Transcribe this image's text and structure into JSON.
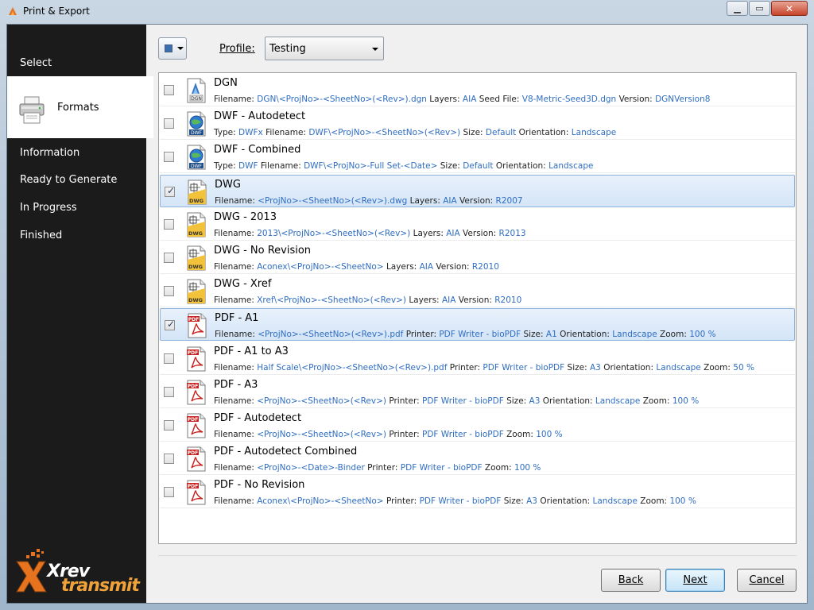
{
  "window": {
    "title": "Print & Export"
  },
  "sidebar": {
    "items": [
      {
        "label": "Select"
      },
      {
        "label": "Formats",
        "active": true
      },
      {
        "label": "Information"
      },
      {
        "label": "Ready to Generate"
      },
      {
        "label": "In Progress"
      },
      {
        "label": "Finished"
      }
    ],
    "logo": {
      "line1": "Xrev",
      "line2": "transmit"
    }
  },
  "toolbar": {
    "profile_label": "Profile:",
    "profile_value": "Testing"
  },
  "formats": [
    {
      "name": "DGN",
      "icon": "dgn-file-icon",
      "checked": false,
      "details": [
        [
          "Filename:",
          "DGN\\<ProjNo>-<SheetNo>(<Rev>).dgn"
        ],
        [
          "Layers:",
          "AIA"
        ],
        [
          "Seed File:",
          "V8-Metric-Seed3D.dgn"
        ],
        [
          "Version:",
          "DGNVersion8"
        ]
      ]
    },
    {
      "name": "DWF - Autodetect",
      "icon": "dwf-file-icon",
      "checked": false,
      "details": [
        [
          "Type:",
          "DWFx"
        ],
        [
          "Filename:",
          "DWF\\<ProjNo>-<SheetNo>(<Rev>)"
        ],
        [
          "Size:",
          "Default"
        ],
        [
          "Orientation:",
          "Landscape"
        ]
      ]
    },
    {
      "name": "DWF - Combined",
      "icon": "dwf-file-icon",
      "checked": false,
      "details": [
        [
          "Type:",
          "DWF"
        ],
        [
          "Filename:",
          "DWF\\<ProjNo>-Full Set-<Date>"
        ],
        [
          "Size:",
          "Default"
        ],
        [
          "Orientation:",
          "Landscape"
        ]
      ]
    },
    {
      "name": "DWG",
      "icon": "dwg-file-icon",
      "checked": true,
      "details": [
        [
          "Filename:",
          "<ProjNo>-<SheetNo>(<Rev>).dwg"
        ],
        [
          "Layers:",
          "AIA"
        ],
        [
          "Version:",
          "R2007"
        ]
      ]
    },
    {
      "name": "DWG - 2013",
      "icon": "dwg-file-icon",
      "checked": false,
      "details": [
        [
          "Filename:",
          "2013\\<ProjNo>-<SheetNo>(<Rev>)"
        ],
        [
          "Layers:",
          "AIA"
        ],
        [
          "Version:",
          "R2013"
        ]
      ]
    },
    {
      "name": "DWG - No Revision",
      "icon": "dwg-file-icon",
      "checked": false,
      "details": [
        [
          "Filename:",
          "Aconex\\<ProjNo>-<SheetNo>"
        ],
        [
          "Layers:",
          "AIA"
        ],
        [
          "Version:",
          "R2010"
        ]
      ]
    },
    {
      "name": "DWG - Xref",
      "icon": "dwg-file-icon",
      "checked": false,
      "details": [
        [
          "Filename:",
          "Xref\\<ProjNo>-<SheetNo>(<Rev>)"
        ],
        [
          "Layers:",
          "AIA"
        ],
        [
          "Version:",
          "R2010"
        ]
      ]
    },
    {
      "name": "PDF - A1",
      "icon": "pdf-file-icon",
      "checked": true,
      "details": [
        [
          "Filename:",
          "<ProjNo>-<SheetNo>(<Rev>).pdf"
        ],
        [
          "Printer:",
          "PDF Writer - bioPDF"
        ],
        [
          "Size:",
          "A1"
        ],
        [
          "Orientation:",
          "Landscape"
        ],
        [
          "Zoom:",
          "100 %"
        ]
      ]
    },
    {
      "name": "PDF - A1 to A3",
      "icon": "pdf-file-icon",
      "checked": false,
      "details": [
        [
          "Filename:",
          "Half Scale\\<ProjNo>-<SheetNo>(<Rev>).pdf"
        ],
        [
          "Printer:",
          "PDF Writer - bioPDF"
        ],
        [
          "Size:",
          "A3"
        ],
        [
          "Orientation:",
          "Landscape"
        ],
        [
          "Zoom:",
          "50 %"
        ]
      ]
    },
    {
      "name": "PDF - A3",
      "icon": "pdf-file-icon",
      "checked": false,
      "details": [
        [
          "Filename:",
          "<ProjNo>-<SheetNo>(<Rev>)"
        ],
        [
          "Printer:",
          "PDF Writer - bioPDF"
        ],
        [
          "Size:",
          "A3"
        ],
        [
          "Orientation:",
          "Landscape"
        ],
        [
          "Zoom:",
          "100 %"
        ]
      ]
    },
    {
      "name": "PDF - Autodetect",
      "icon": "pdf-file-icon",
      "checked": false,
      "details": [
        [
          "Filename:",
          "<ProjNo>-<SheetNo>(<Rev>)"
        ],
        [
          "Printer:",
          "PDF Writer - bioPDF"
        ],
        [
          "Zoom:",
          "100 %"
        ]
      ]
    },
    {
      "name": "PDF - Autodetect Combined",
      "icon": "pdf-file-icon",
      "checked": false,
      "details": [
        [
          "Filename:",
          "<ProjNo>-<Date>-Binder"
        ],
        [
          "Printer:",
          "PDF Writer - bioPDF"
        ],
        [
          "Zoom:",
          "100 %"
        ]
      ]
    },
    {
      "name": "PDF - No Revision",
      "icon": "pdf-file-icon",
      "checked": false,
      "details": [
        [
          "Filename:",
          "Aconex\\<ProjNo>-<SheetNo>"
        ],
        [
          "Printer:",
          "PDF Writer - bioPDF"
        ],
        [
          "Size:",
          "A3"
        ],
        [
          "Orientation:",
          "Landscape"
        ],
        [
          "Zoom:",
          "100 %"
        ]
      ]
    }
  ],
  "footer": {
    "back_label": "Back",
    "next_label": "Next",
    "cancel_label": "Cancel"
  },
  "colors": {
    "value_text": "#2f6dc2",
    "sidebar_bg": "#1b1b1b",
    "selected_row": "#d4e5f7"
  }
}
